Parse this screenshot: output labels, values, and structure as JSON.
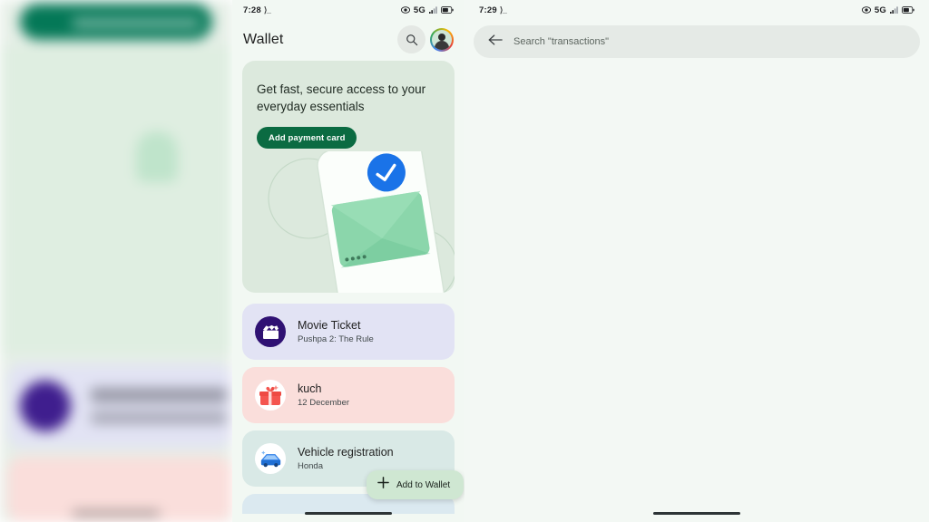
{
  "left_panel": {
    "description": "blurred background duplicate of wallet screen"
  },
  "middle_panel": {
    "status_bar": {
      "time": "7:28",
      "dev_icon": "developer-mode-icon",
      "vpn_icon": "vpn-eye-icon",
      "network": "5G",
      "signal_icon": "signal-bars-icon",
      "battery_icon": "battery-icon"
    },
    "header": {
      "title": "Wallet",
      "search_icon": "search-icon",
      "avatar": "account-avatar"
    },
    "hero": {
      "headline": "Get fast, secure access to your everyday essentials",
      "button_label": "Add payment card",
      "art": {
        "check_icon": "check-circle-icon",
        "shield_icon": "shield-outline-icon",
        "card_dots": "••••"
      }
    },
    "passes": [
      {
        "title": "Movie Ticket",
        "subtitle": "Pushpa 2: The Rule",
        "icon": "movie-clapperboard-icon",
        "icon_bg": "#2f1173",
        "card_bg": "#e2e3f4"
      },
      {
        "title": "kuch",
        "subtitle": "12 December",
        "icon": "gift-icon",
        "icon_bg": "#ffffff",
        "card_bg": "#fadedb"
      },
      {
        "title": "Vehicle registration",
        "subtitle": "Honda",
        "icon": "car-icon",
        "icon_bg": "#ffffff",
        "card_bg": "#d9e9e6"
      }
    ],
    "fab": {
      "plus_icon": "plus-icon",
      "label": "Add to Wallet"
    }
  },
  "right_panel": {
    "status_bar": {
      "time": "7:29",
      "dev_icon": "developer-mode-icon",
      "vpn_icon": "vpn-eye-icon",
      "network": "5G",
      "signal_icon": "signal-bars-icon",
      "battery_icon": "battery-icon"
    },
    "search": {
      "back_icon": "back-arrow-icon",
      "placeholder": "Search \"transactions\"",
      "value": ""
    }
  },
  "colors": {
    "brand_green": "#0b6b42",
    "hero_bg": "#dce9dd",
    "page_bg": "#f2f8f3",
    "fab_bg": "#cfe7d2",
    "check_blue": "#1a73e8"
  }
}
